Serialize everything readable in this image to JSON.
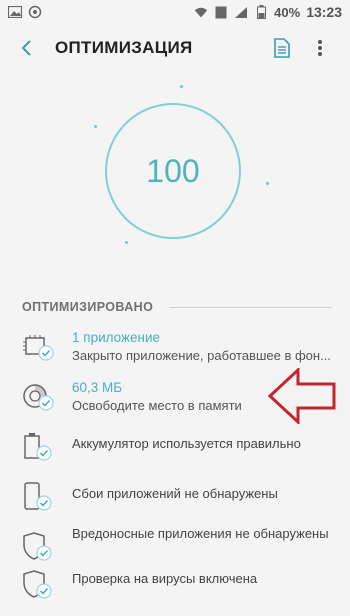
{
  "status_bar": {
    "battery": "40%",
    "time": "13:23",
    "sim_label": "1"
  },
  "header": {
    "title": "ОПТИМИЗАЦИЯ",
    "back_icon": "arrow-back-icon",
    "doc_icon": "document-icon",
    "more_icon": "more-vert-icon"
  },
  "gauge": {
    "score": "100",
    "color": "#7fcfd6"
  },
  "section": {
    "title": "ОПТИМИЗИРОВАНО"
  },
  "items": [
    {
      "title": "1 приложение",
      "subtitle": "Закрыто приложение, работавшее в фон...",
      "icon": "chip-check-icon"
    },
    {
      "title": "60,3 МБ",
      "subtitle": "Освободите место в памяти",
      "icon": "storage-check-icon"
    },
    {
      "text": "Аккумулятор используется правильно",
      "icon": "battery-check-icon"
    },
    {
      "text": "Сбои приложений не обнаружены",
      "icon": "phone-check-icon"
    },
    {
      "text": "Вредоносные приложения не обнаружены",
      "icon": "shield-check-icon"
    },
    {
      "text": "Проверка на вирусы включена",
      "icon": "shield-check-icon"
    }
  ],
  "colors": {
    "accent": "#47b0c0",
    "arrow": "#c0282d",
    "background": "#f4f4f4"
  }
}
